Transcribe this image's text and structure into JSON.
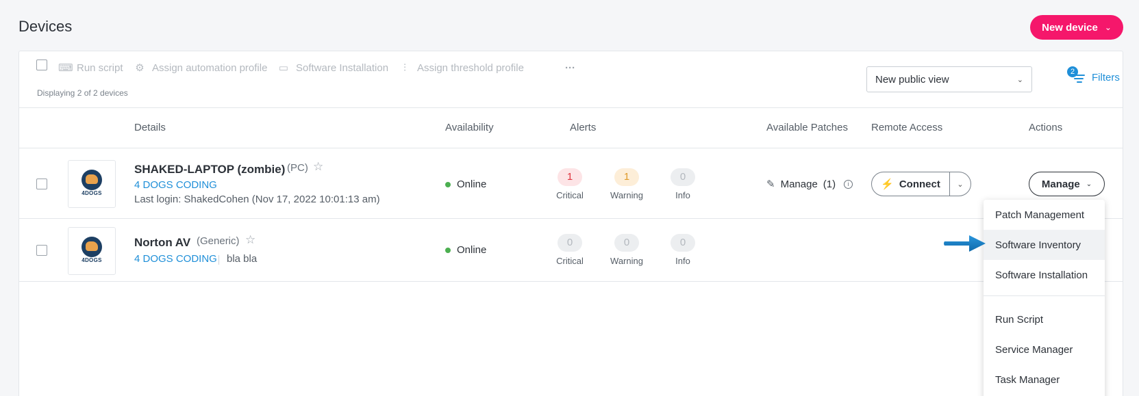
{
  "page": {
    "title": "Devices",
    "new_device_label": "New device"
  },
  "toolbar": {
    "actions": [
      {
        "label": "Run script",
        "icon": "script-icon"
      },
      {
        "label": "Assign automation profile",
        "icon": "automation-icon"
      },
      {
        "label": "Software Installation",
        "icon": "install-icon"
      },
      {
        "label": "Assign threshold profile",
        "icon": "threshold-icon"
      }
    ],
    "more_label": "···",
    "display_count": "Displaying 2 of 2 devices",
    "view_select": "New public view",
    "filters_label": "Filters",
    "filters_count": "2"
  },
  "columns": {
    "details": "Details",
    "availability": "Availability",
    "alerts": "Alerts",
    "patches": "Available Patches",
    "remote": "Remote Access",
    "actions": "Actions"
  },
  "devices": [
    {
      "name": "SHAKED-LAPTOP (zombie)",
      "type": "(PC)",
      "company": "4 DOGS CODING",
      "last_login": "Last login: ShakedCohen (Nov 17, 2022 10:01:13 am)",
      "status": "Online",
      "alerts": {
        "critical": "1",
        "warning": "1",
        "info": "0"
      },
      "patches": "Manage",
      "patches_count": "(1)",
      "connect_label": "Connect",
      "manage_label": "Manage"
    },
    {
      "name": "Norton AV",
      "type": "(Generic)",
      "company": "4 DOGS CODING",
      "description": "bla bla",
      "status": "Online",
      "alerts": {
        "critical": "0",
        "warning": "0",
        "info": "0"
      }
    }
  ],
  "alert_labels": {
    "critical": "Critical",
    "warning": "Warning",
    "info": "Info"
  },
  "logo_text": "4DOGS",
  "manage_menu": {
    "items": [
      "Patch Management",
      "Software Inventory",
      "Software Installation",
      "Run Script",
      "Service Manager",
      "Task Manager"
    ],
    "highlighted": "Software Inventory"
  },
  "colors": {
    "accent": "#f5176b",
    "link": "#1f8fd8",
    "online": "#4caf50",
    "annotation_arrow": "#1a7bc4"
  }
}
